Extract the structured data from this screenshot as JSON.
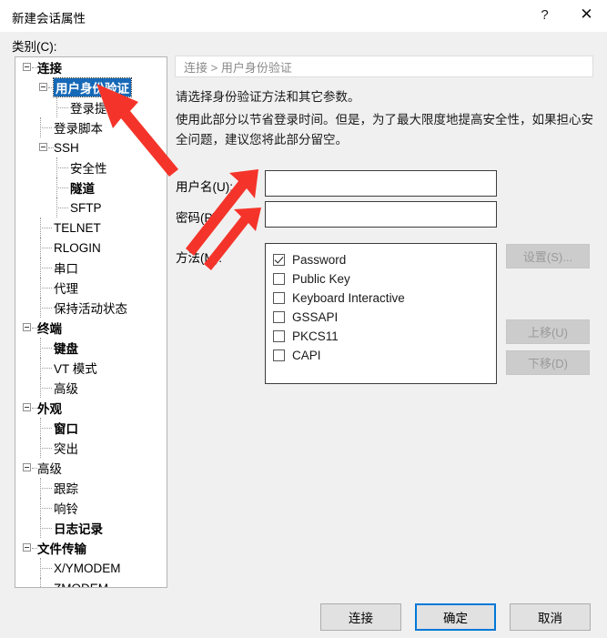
{
  "window": {
    "title": "新建会话属性",
    "help_icon": "question-mark-icon",
    "help_label": "?",
    "close_label": "✕"
  },
  "category": {
    "label": "类别(C):"
  },
  "tree": {
    "items": [
      {
        "label": "连接",
        "level": 0,
        "bold": true,
        "expander": true,
        "selected": false
      },
      {
        "label": "用户身份验证",
        "level": 1,
        "bold": true,
        "expander": true,
        "selected": true
      },
      {
        "label": "登录提示符",
        "level": 2,
        "bold": false,
        "expander": false,
        "selected": false
      },
      {
        "label": "登录脚本",
        "level": 1,
        "bold": false,
        "expander": false,
        "selected": false
      },
      {
        "label": "SSH",
        "level": 1,
        "bold": false,
        "expander": true,
        "selected": false
      },
      {
        "label": "安全性",
        "level": 2,
        "bold": false,
        "expander": false,
        "selected": false
      },
      {
        "label": "隧道",
        "level": 2,
        "bold": true,
        "expander": false,
        "selected": false
      },
      {
        "label": "SFTP",
        "level": 2,
        "bold": false,
        "expander": false,
        "selected": false
      },
      {
        "label": "TELNET",
        "level": 1,
        "bold": false,
        "expander": false,
        "selected": false
      },
      {
        "label": "RLOGIN",
        "level": 1,
        "bold": false,
        "expander": false,
        "selected": false
      },
      {
        "label": "串口",
        "level": 1,
        "bold": false,
        "expander": false,
        "selected": false
      },
      {
        "label": "代理",
        "level": 1,
        "bold": false,
        "expander": false,
        "selected": false
      },
      {
        "label": "保持活动状态",
        "level": 1,
        "bold": false,
        "expander": false,
        "selected": false
      },
      {
        "label": "终端",
        "level": 0,
        "bold": true,
        "expander": true,
        "selected": false
      },
      {
        "label": "键盘",
        "level": 1,
        "bold": true,
        "expander": false,
        "selected": false
      },
      {
        "label": "VT 模式",
        "level": 1,
        "bold": false,
        "expander": false,
        "selected": false
      },
      {
        "label": "高级",
        "level": 1,
        "bold": false,
        "expander": false,
        "selected": false
      },
      {
        "label": "外观",
        "level": 0,
        "bold": true,
        "expander": true,
        "selected": false
      },
      {
        "label": "窗口",
        "level": 1,
        "bold": true,
        "expander": false,
        "selected": false
      },
      {
        "label": "突出",
        "level": 1,
        "bold": false,
        "expander": false,
        "selected": false
      },
      {
        "label": "高级",
        "level": 0,
        "bold": false,
        "expander": true,
        "selected": false
      },
      {
        "label": "跟踪",
        "level": 1,
        "bold": false,
        "expander": false,
        "selected": false
      },
      {
        "label": "响铃",
        "level": 1,
        "bold": false,
        "expander": false,
        "selected": false
      },
      {
        "label": "日志记录",
        "level": 1,
        "bold": true,
        "expander": false,
        "selected": false
      },
      {
        "label": "文件传输",
        "level": 0,
        "bold": true,
        "expander": true,
        "selected": false
      },
      {
        "label": "X/YMODEM",
        "level": 1,
        "bold": false,
        "expander": false,
        "selected": false
      },
      {
        "label": "ZMODEM",
        "level": 1,
        "bold": false,
        "expander": false,
        "selected": false
      }
    ]
  },
  "content": {
    "breadcrumb": "连接  >  用户身份验证",
    "description_line1": "请选择身份验证方法和其它参数。",
    "description_line2": "使用此部分以节省登录时间。但是，为了最大限度地提高安全性，如果担心安全问题，建议您将此部分留空。",
    "username": {
      "label": "用户名(U):",
      "value": "",
      "placeholder": ""
    },
    "password": {
      "label": "密码(P):",
      "value": "",
      "placeholder": ""
    },
    "method": {
      "label": "方法(M):"
    },
    "methods": [
      {
        "label": "Password",
        "checked": true
      },
      {
        "label": "Public Key",
        "checked": false
      },
      {
        "label": "Keyboard Interactive",
        "checked": false
      },
      {
        "label": "GSSAPI",
        "checked": false
      },
      {
        "label": "PKCS11",
        "checked": false
      },
      {
        "label": "CAPI",
        "checked": false
      }
    ],
    "side_buttons": {
      "settings": "设置(S)...",
      "move_up": "上移(U)",
      "move_down": "下移(D)"
    }
  },
  "footer": {
    "connect": "连接",
    "ok": "确定",
    "cancel": "取消"
  },
  "annotations": {
    "arrow_color": "#f4342a",
    "arrow_count": 3
  },
  "colors": {
    "dialog_background": "#f0f0f0",
    "selection_blue": "#1669b7",
    "focus_blue": "#0078d7",
    "panel_white": "#ffffff",
    "disabled_gray": "#cccccc"
  }
}
